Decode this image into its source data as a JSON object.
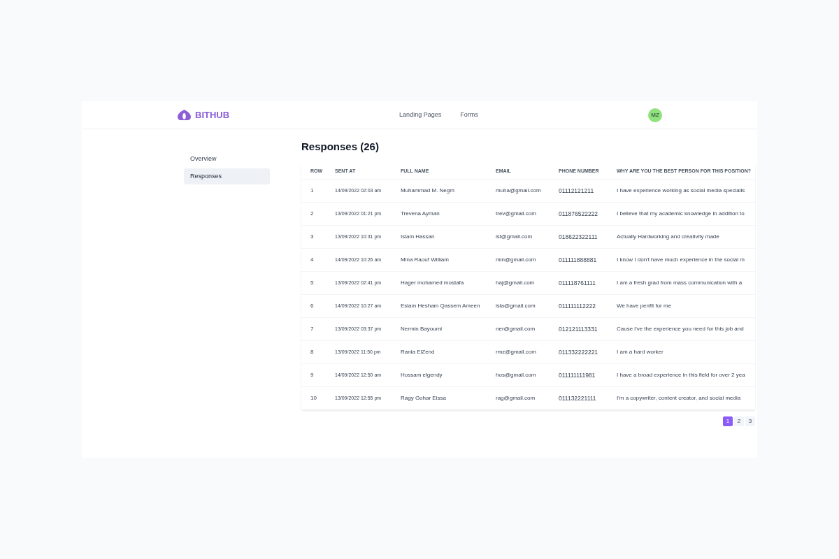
{
  "header": {
    "brand": "BITHUB",
    "nav": [
      {
        "label": "Landing Pages"
      },
      {
        "label": "Forms"
      }
    ],
    "avatar": {
      "initials": "MZ"
    }
  },
  "sidebar": {
    "items": [
      {
        "label": "Overview",
        "selected": false
      },
      {
        "label": "Responses",
        "selected": true
      }
    ]
  },
  "responses": {
    "title": "Responses (26)",
    "table": {
      "columns": [
        "ROW",
        "SENT AT",
        "FULL NAME",
        "EMAIL",
        "PHONE NUMBER",
        "WHY ARE YOU THE BEST PERSON FOR THIS POSITION?"
      ],
      "rows": [
        [
          "1",
          "14/09/2022 02:03 am",
          "Muhammad M. Negm",
          "muha@gmail.com",
          "01112121211",
          "I have experience working as social media specialis"
        ],
        [
          "2",
          "13/09/2022 01:21 pm",
          "Trevena Ayman",
          "trev@gmail.com",
          "011876522222",
          "I believe that my academic knowledge in addition to"
        ],
        [
          "3",
          "13/09/2022 10:31 pm",
          "Islam Hassan",
          "isl@gmail.com",
          "018622322111",
          "Actually Hardworking and creativity made"
        ],
        [
          "4",
          "14/09/2022 10:26 am",
          "Mina Raouf William",
          "min@gmail.com",
          "011111888881",
          "I know I don't have much experience in the social m"
        ],
        [
          "5",
          "13/09/2022 02:41 pm",
          "Hager mohamed mostafa",
          "haj@gmail.com",
          "011118761111",
          "I am a fresh grad from mass communication with a"
        ],
        [
          "6",
          "14/09/2022 10:27 am",
          "Eslam Hesham Qassem Ameen",
          "isla@gmail.com",
          "011111112222",
          "We have penfit for me"
        ],
        [
          "7",
          "13/09/2022 03:37 pm",
          "Nermin Bayoumi",
          "ner@gmail.com",
          "012121113331",
          "Cause i've the experience you need for this job and"
        ],
        [
          "8",
          "13/09/2022 11:50 pm",
          "Rania ElZend",
          "rmz@gmail.com",
          "011332222221",
          "I am a hard worker"
        ],
        [
          "9",
          "14/09/2022 12:50 am",
          "Hossam elgendy",
          "hos@gmail.com",
          "011111111981",
          "I have a broad experience in this field for over 2 yea"
        ],
        [
          "10",
          "13/09/2022 12:55 pm",
          "Ragy Gohar Eissa",
          "rag@gmail.com",
          "011132221111",
          "I'm a copywriter, content creator, and social media"
        ]
      ]
    },
    "pagination": [
      {
        "label": "1",
        "selected": true
      },
      {
        "label": "2",
        "selected": false
      },
      {
        "label": "3",
        "selected": false
      }
    ]
  }
}
